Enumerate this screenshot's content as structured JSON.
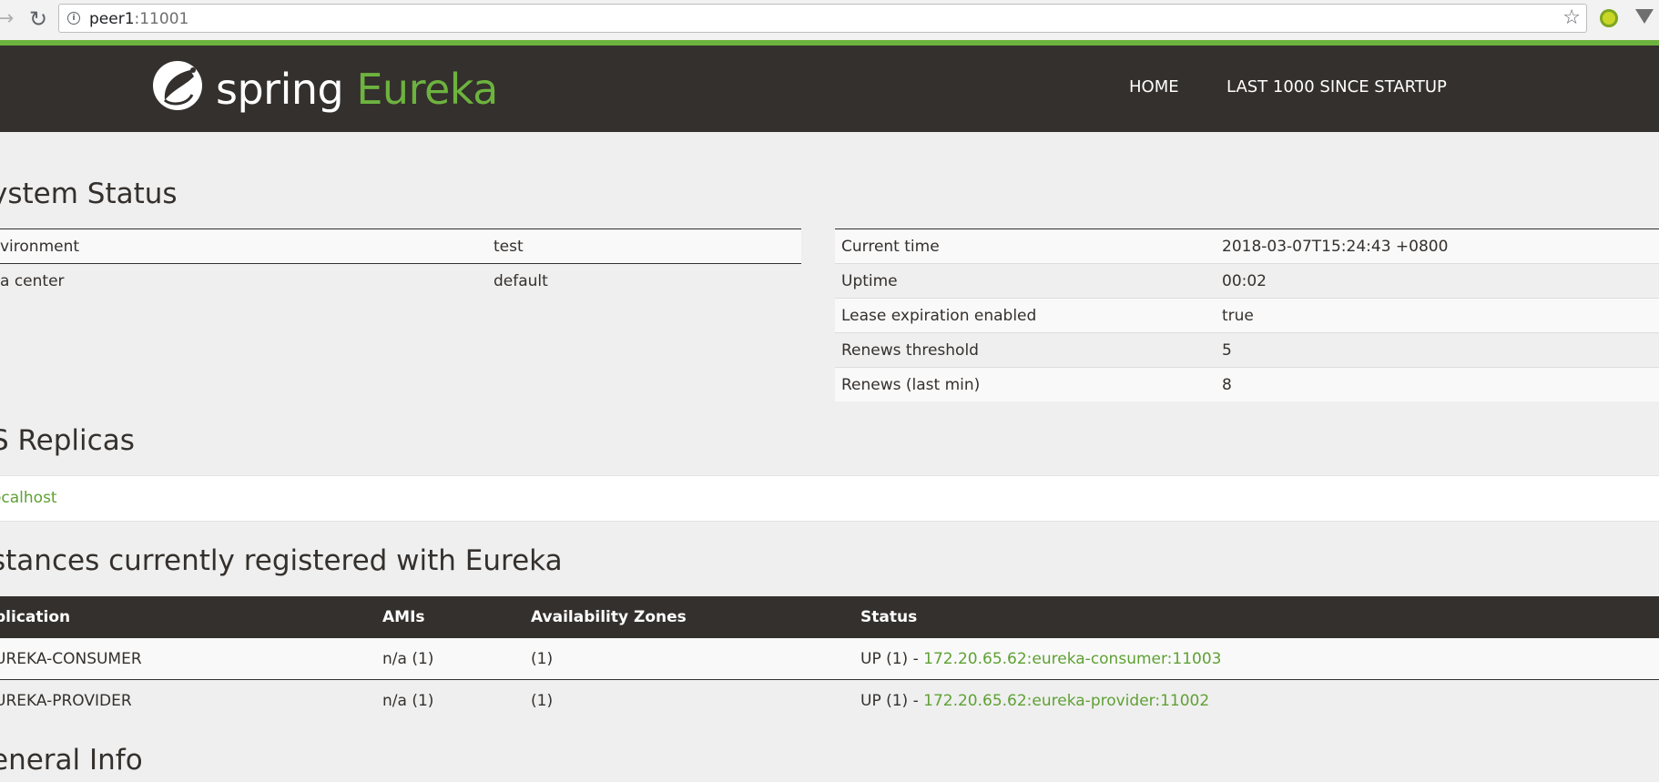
{
  "browser": {
    "url_host": "peer1",
    "url_port": ":11001"
  },
  "header": {
    "logo_spring": "spring",
    "logo_eureka": "Eureka",
    "nav": [
      {
        "label": "HOME"
      },
      {
        "label": "LAST 1000 SINCE STARTUP"
      }
    ]
  },
  "system_status": {
    "title": "ystem Status",
    "left": [
      {
        "key": "vironment",
        "value": "test"
      },
      {
        "key": "a center",
        "value": "default"
      }
    ],
    "right": [
      {
        "key": "Current time",
        "value": "2018-03-07T15:24:43 +0800"
      },
      {
        "key": "Uptime",
        "value": "00:02"
      },
      {
        "key": "Lease expiration enabled",
        "value": "true"
      },
      {
        "key": "Renews threshold",
        "value": "5"
      },
      {
        "key": "Renews (last min)",
        "value": "8"
      }
    ]
  },
  "replicas": {
    "title": "S Replicas",
    "items": [
      "ocalhost"
    ]
  },
  "instances": {
    "title": "stances currently registered with Eureka",
    "columns": [
      "plication",
      "AMIs",
      "Availability Zones",
      "Status"
    ],
    "rows": [
      {
        "application": "UREKA-CONSUMER",
        "amis": "n/a (1)",
        "zones": "(1)",
        "status_prefix": "UP (1) - ",
        "status_link": "172.20.65.62:eureka-consumer:11003"
      },
      {
        "application": "UREKA-PROVIDER",
        "amis": "n/a (1)",
        "zones": "(1)",
        "status_prefix": "UP (1) - ",
        "status_link": "172.20.65.62:eureka-provider:11002"
      }
    ]
  },
  "general_info": {
    "title": "eneral Info"
  },
  "colors": {
    "spring_green": "#6db33f",
    "header_dark": "#34302d",
    "link_green": "#5fa134",
    "page_bg": "#efefef"
  }
}
